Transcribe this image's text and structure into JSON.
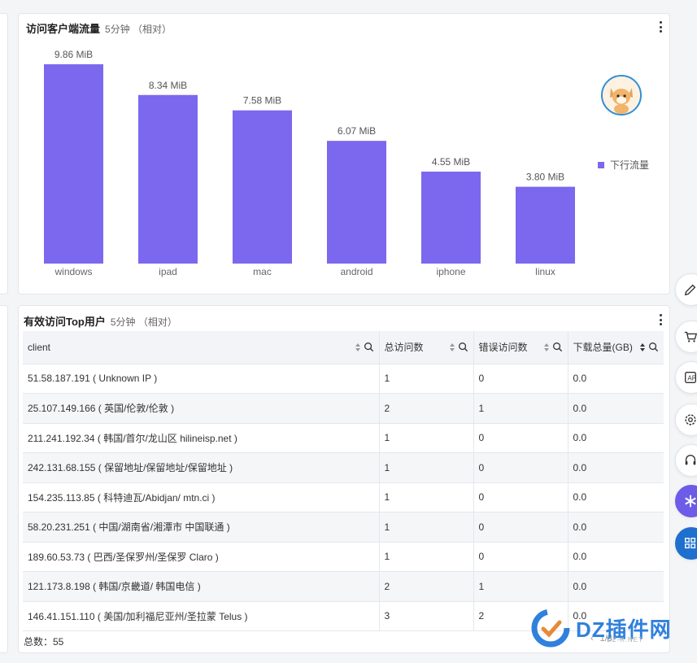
{
  "chart_card": {
    "title": "访问客户端流量",
    "subtitle": "5分钟 （相对）",
    "legend_label": "下行流量"
  },
  "chart_data": {
    "type": "bar",
    "title": "访问客户端流量",
    "categories": [
      "windows",
      "ipad",
      "mac",
      "android",
      "iphone",
      "linux"
    ],
    "series": [
      {
        "name": "下行流量",
        "values": [
          9.86,
          8.34,
          7.58,
          6.07,
          4.55,
          3.8
        ],
        "labels": [
          "9.86 MiB",
          "8.34 MiB",
          "7.58 MiB",
          "6.07 MiB",
          "4.55 MiB",
          "3.80 MiB"
        ]
      }
    ],
    "unit": "MiB",
    "ylim": [
      0,
      9.86
    ],
    "grid": false,
    "legend_position": "right",
    "color": "#7b68ee"
  },
  "table_card": {
    "title": "有效访问Top用户",
    "subtitle": "5分钟 （相对）",
    "columns": [
      "client",
      "总访问数",
      "错误访问数",
      "下载总量(GB)"
    ],
    "rows": [
      [
        "51.58.187.191 ( Unknown IP )",
        "1",
        "0",
        "0.0"
      ],
      [
        "25.107.149.166 ( 英国/伦敦/伦敦  )",
        "2",
        "1",
        "0.0"
      ],
      [
        "211.241.192.34 ( 韩国/首尔/龙山区 hilineisp.net )",
        "1",
        "0",
        "0.0"
      ],
      [
        "242.131.68.155 ( 保留地址/保留地址/保留地址  )",
        "1",
        "0",
        "0.0"
      ],
      [
        "154.235.113.85 ( 科特迪瓦/Abidjan/ mtn.ci )",
        "1",
        "0",
        "0.0"
      ],
      [
        "58.20.231.251 ( 中国/湖南省/湘潭市 中国联通 )",
        "1",
        "0",
        "0.0"
      ],
      [
        "189.60.53.73 ( 巴西/圣保罗州/圣保罗 Claro )",
        "1",
        "0",
        "0.0"
      ],
      [
        "121.173.8.198 ( 韩国/京畿道/ 韩国电信 )",
        "2",
        "1",
        "0.0"
      ],
      [
        "146.41.151.110 ( 美国/加利福尼亚州/圣拉蒙 Telus )",
        "3",
        "2",
        "0.0"
      ]
    ],
    "total_label": "总数：55",
    "pager_text": "1/3"
  },
  "side_tools": [
    "edit-icon",
    "cart-icon",
    "api-icon",
    "settings-icon",
    "headset-icon",
    "plugin-icon",
    "apps-icon"
  ],
  "watermark": {
    "text": "DZ插件网",
    "sub": "DZ-X.NET"
  },
  "colors": {
    "bar": "#7b68ee",
    "accent_blue": "#1f6fce"
  }
}
